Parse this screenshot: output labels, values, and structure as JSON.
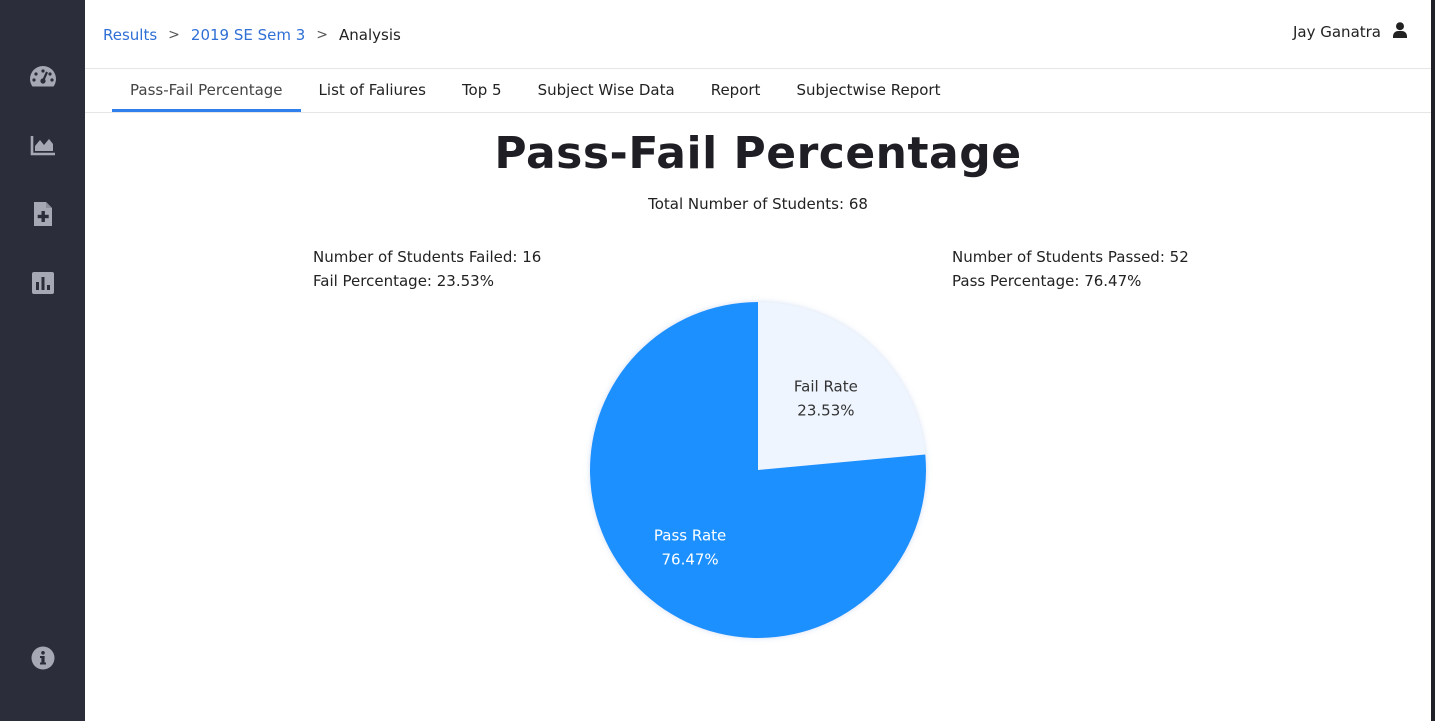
{
  "sidebar": {
    "items": [
      {
        "icon": "dashboard-gauge-icon"
      },
      {
        "icon": "area-chart-icon"
      },
      {
        "icon": "file-add-icon"
      },
      {
        "icon": "bar-chart-icon"
      }
    ],
    "bottom_icon": "info-icon",
    "colors": {
      "background": "#2b2d3b",
      "icon": "#a6a8b3"
    }
  },
  "breadcrumb": {
    "items": [
      "Results",
      "2019 SE Sem 3"
    ],
    "current": "Analysis",
    "separator": ">"
  },
  "user": {
    "name": "Jay Ganatra",
    "icon": "user-icon"
  },
  "tabs": [
    {
      "label": "Pass-Fail Percentage",
      "active": true
    },
    {
      "label": "List of Faliures",
      "active": false
    },
    {
      "label": "Top 5",
      "active": false
    },
    {
      "label": "Subject Wise Data",
      "active": false
    },
    {
      "label": "Report",
      "active": false
    },
    {
      "label": "Subjectwise Report",
      "active": false
    }
  ],
  "main": {
    "title": "Pass-Fail Percentage",
    "total_label": "Total Number of Students:",
    "total_value": "68",
    "failed_label": "Number of Students Failed:",
    "failed_value": "16",
    "fail_pct_label": "Fail Percentage:",
    "fail_pct_value": "23.53%",
    "passed_label": "Number of Students Passed:",
    "passed_value": "52",
    "pass_pct_label": "Pass Percentage:",
    "pass_pct_value": "76.47%"
  },
  "chart_data": {
    "type": "pie",
    "categories": [
      "Fail Rate",
      "Pass Rate"
    ],
    "values": [
      23.53,
      76.47
    ],
    "labels": [
      "23.53%",
      "76.47%"
    ],
    "colors": [
      "#eef5ff",
      "#1e90ff"
    ],
    "label_colors": [
      "#333333",
      "#ffffff"
    ],
    "start": "12 o'clock, clockwise"
  },
  "colors": {
    "accent": "#2f80ed",
    "link": "#2f6fd6"
  }
}
